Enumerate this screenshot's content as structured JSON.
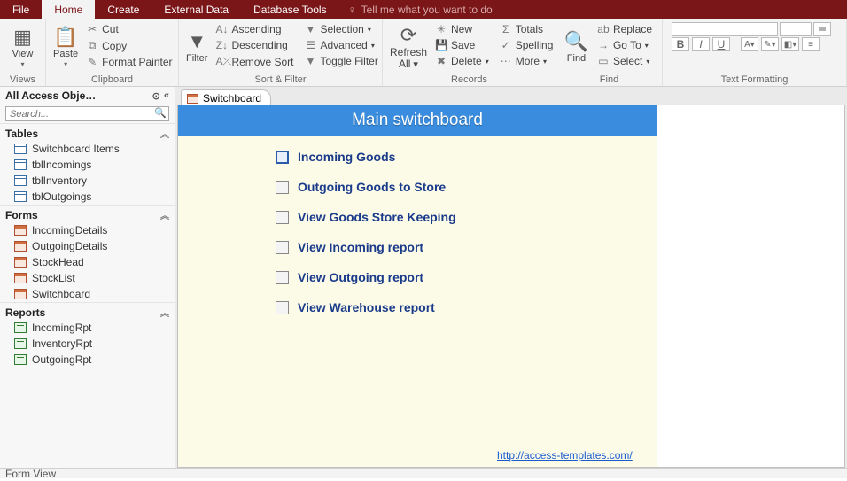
{
  "menu": {
    "tabs": [
      "File",
      "Home",
      "Create",
      "External Data",
      "Database Tools"
    ],
    "active": 1,
    "tell_me": "Tell me what you want to do"
  },
  "ribbon": {
    "views": {
      "label": "Views",
      "view": "View"
    },
    "clipboard": {
      "label": "Clipboard",
      "paste": "Paste",
      "cut": "Cut",
      "copy": "Copy",
      "format_painter": "Format Painter"
    },
    "sort_filter": {
      "label": "Sort & Filter",
      "filter": "Filter",
      "ascending": "Ascending",
      "descending": "Descending",
      "remove_sort": "Remove Sort",
      "selection": "Selection",
      "advanced": "Advanced",
      "toggle_filter": "Toggle Filter"
    },
    "records": {
      "label": "Records",
      "refresh": "Refresh All",
      "new": "New",
      "save": "Save",
      "delete": "Delete",
      "totals": "Totals",
      "spelling": "Spelling",
      "more": "More"
    },
    "find": {
      "label": "Find",
      "find": "Find",
      "replace": "Replace",
      "goto": "Go To",
      "select": "Select"
    },
    "text_formatting": {
      "label": "Text Formatting"
    }
  },
  "nav": {
    "title": "All Access Obje…",
    "search_placeholder": "Search...",
    "sections": [
      {
        "name": "Tables",
        "type": "table",
        "items": [
          "Switchboard Items",
          "tblIncomings",
          "tblInventory",
          "tblOutgoings"
        ]
      },
      {
        "name": "Forms",
        "type": "form",
        "items": [
          "IncomingDetails",
          "OutgoingDetails",
          "StockHead",
          "StockList",
          "Switchboard"
        ]
      },
      {
        "name": "Reports",
        "type": "report",
        "items": [
          "IncomingRpt",
          "InventoryRpt",
          "OutgoingRpt"
        ]
      }
    ]
  },
  "doc": {
    "tab": "Switchboard",
    "title": "Main switchboard",
    "items": [
      "Incoming Goods",
      "Outgoing Goods to Store",
      "View Goods Store Keeping",
      "View Incoming report",
      "View Outgoing report",
      "View Warehouse report"
    ],
    "selected": 0,
    "link": "http://access-templates.com/"
  },
  "status": "Form View"
}
